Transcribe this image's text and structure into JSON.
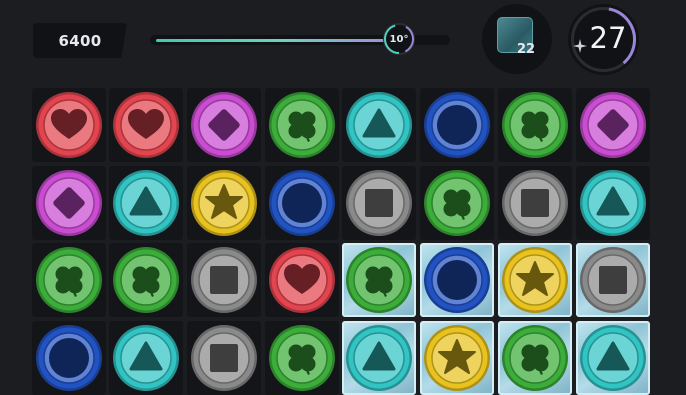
{
  "hud": {
    "score": "6400",
    "progress": 0.81,
    "progress_marker": "10°",
    "goal_count": "22",
    "moves_left": "27",
    "goal_icon": "ice-tile-icon",
    "moves_icon": "sparkle-icon"
  },
  "colors": {
    "red": "#e2454f",
    "magenta": "#c94cd1",
    "green": "#3cad3a",
    "cyan": "#32c3c3",
    "blue": "#2253c2",
    "yellow": "#e8c320",
    "gray": "#8a8a8a"
  },
  "board": {
    "columns": 8,
    "rows": [
      [
        {
          "color": "red",
          "symbol": "heart",
          "ice": false
        },
        {
          "color": "red",
          "symbol": "heart",
          "ice": false
        },
        {
          "color": "magenta",
          "symbol": "diamond",
          "ice": false
        },
        {
          "color": "green",
          "symbol": "clover",
          "ice": false
        },
        {
          "color": "cyan",
          "symbol": "triangle",
          "ice": false
        },
        {
          "color": "blue",
          "symbol": "circle",
          "ice": false
        },
        {
          "color": "green",
          "symbol": "clover",
          "ice": false
        },
        {
          "color": "magenta",
          "symbol": "diamond",
          "ice": false
        }
      ],
      [
        {
          "color": "magenta",
          "symbol": "diamond",
          "ice": false
        },
        {
          "color": "cyan",
          "symbol": "triangle",
          "ice": false
        },
        {
          "color": "yellow",
          "symbol": "star",
          "ice": false
        },
        {
          "color": "blue",
          "symbol": "circle",
          "ice": false
        },
        {
          "color": "gray",
          "symbol": "square",
          "ice": false
        },
        {
          "color": "green",
          "symbol": "clover",
          "ice": false
        },
        {
          "color": "gray",
          "symbol": "square",
          "ice": false
        },
        {
          "color": "cyan",
          "symbol": "triangle",
          "ice": false
        }
      ],
      [
        {
          "color": "green",
          "symbol": "clover",
          "ice": false
        },
        {
          "color": "green",
          "symbol": "clover",
          "ice": false
        },
        {
          "color": "gray",
          "symbol": "square",
          "ice": false
        },
        {
          "color": "red",
          "symbol": "heart",
          "ice": false
        },
        {
          "color": "green",
          "symbol": "clover",
          "ice": true
        },
        {
          "color": "blue",
          "symbol": "circle",
          "ice": true
        },
        {
          "color": "yellow",
          "symbol": "star",
          "ice": true
        },
        {
          "color": "gray",
          "symbol": "square",
          "ice": true
        }
      ],
      [
        {
          "color": "blue",
          "symbol": "circle",
          "ice": false
        },
        {
          "color": "cyan",
          "symbol": "triangle",
          "ice": false
        },
        {
          "color": "gray",
          "symbol": "square",
          "ice": false
        },
        {
          "color": "green",
          "symbol": "clover",
          "ice": false
        },
        {
          "color": "cyan",
          "symbol": "triangle",
          "ice": true
        },
        {
          "color": "yellow",
          "symbol": "star",
          "ice": true
        },
        {
          "color": "green",
          "symbol": "clover",
          "ice": true
        },
        {
          "color": "cyan",
          "symbol": "triangle",
          "ice": true
        }
      ]
    ]
  }
}
